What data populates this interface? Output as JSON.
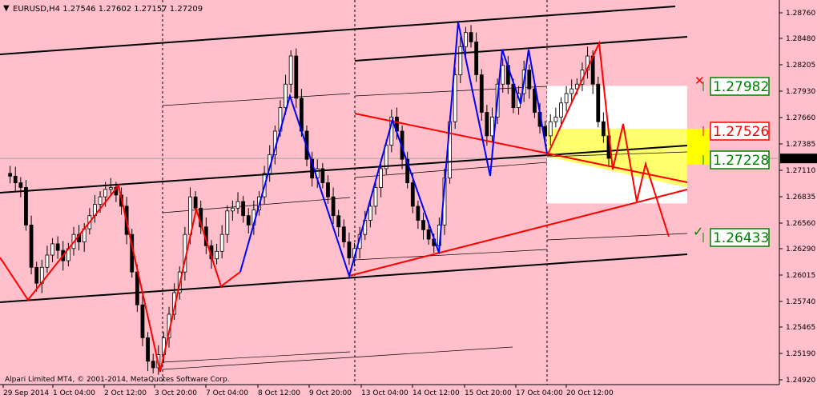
{
  "window": {
    "title": "EURUSD,H4  1.27546 1.27602 1.27157 1.27209",
    "copyright": "Alpari Limited MT4, © 2001-2014, MetaQuotes Software Corp."
  },
  "chart_data": {
    "type": "candlestick",
    "symbol": "EURUSD",
    "timeframe": "H4",
    "ohlc": {
      "open": 1.27546,
      "high": 1.27602,
      "low": 1.27157,
      "close": 1.27209
    },
    "current_price": 1.27209,
    "ylim": [
      1.2485,
      1.2886
    ],
    "price_ticks": [
      "1.28760",
      "1.28480",
      "1.28205",
      "1.27930",
      "1.27660",
      "1.27385",
      "1.27110",
      "1.26835",
      "1.26560",
      "1.26290",
      "1.26015",
      "1.25740",
      "1.25465",
      "1.25190",
      "1.24920"
    ],
    "time_ticks": [
      "29 Sep 2014",
      "1 Oct 04:00",
      "2 Oct 12:00",
      "3 Oct 20:00",
      "7 Oct 04:00",
      "8 Oct 12:00",
      "9 Oct 20:00",
      "13 Oct 04:00",
      "14 Oct 12:00",
      "15 Oct 20:00",
      "17 Oct 04:00",
      "20 Oct 12:00"
    ],
    "levels": [
      {
        "label": "1.27982",
        "color": "#008000",
        "marker": "cross"
      },
      {
        "label": "1.27526",
        "color": "#ff0000",
        "marker": "none"
      },
      {
        "label": "1.27228",
        "color": "#008000",
        "marker": "none"
      },
      {
        "label": "1.26433",
        "color": "#008000",
        "marker": "check"
      }
    ],
    "grid": true,
    "colors": {
      "background": "#ffc0cb",
      "zigzag_up": "#0000ff",
      "zigzag_down": "#ff0000",
      "channel": "#000000",
      "zone": "#ffff66",
      "box": "#ffffff"
    }
  }
}
